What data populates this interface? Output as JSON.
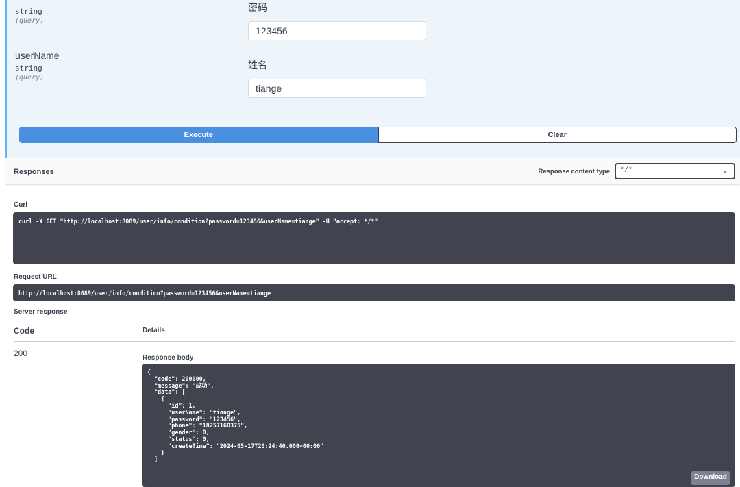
{
  "parameters": [
    {
      "name": "",
      "type": "string",
      "in": "(query)",
      "description": "密码",
      "value": "123456"
    },
    {
      "name": "userName",
      "type": "string",
      "in": "(query)",
      "description": "姓名",
      "value": "tiange"
    }
  ],
  "actions": {
    "execute_label": "Execute",
    "clear_label": "Clear"
  },
  "responses": {
    "title": "Responses",
    "content_type_label": "Response content type",
    "content_type_value": "*/*",
    "curl_label": "Curl",
    "curl_command": "curl -X GET \"http://localhost:8089/user/info/condition?password=123456&userName=tiange\" -H \"accept: */*\"",
    "request_url_label": "Request URL",
    "request_url": "http://localhost:8089/user/info/condition?password=123456&userName=tiange",
    "server_response_label": "Server response",
    "code_header": "Code",
    "details_header": "Details",
    "code": "200",
    "response_body_label": "Response body",
    "response_body": "{\n  \"code\": 200000,\n  \"message\": \"成功\",\n  \"data\": [\n    {\n      \"id\": 1,\n      \"userName\": \"tiange\",\n      \"password\": \"123456\",\n      \"phone\": \"18257160375\",\n      \"gender\": 0,\n      \"status\": 0,\n      \"createTime\": \"2024-05-17T20:24:40.000+00:00\"\n    }\n  ]",
    "download_label": "Download"
  },
  "colors": {
    "execute": "#4990e2",
    "code_bg": "#41444e",
    "param_bg": "#edf5fb"
  }
}
